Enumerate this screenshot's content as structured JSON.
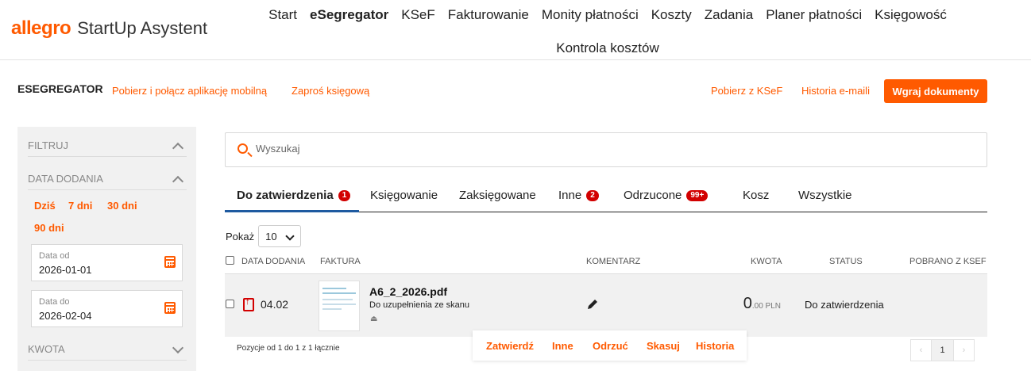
{
  "app": {
    "brand": "allegro",
    "subtitle": "StartUp Asystent"
  },
  "nav": {
    "items": [
      "Start",
      "eSegregator",
      "KSeF",
      "Fakturowanie",
      "Monity płatności",
      "Koszty",
      "Zadania",
      "Planer płatności",
      "Księgowość"
    ],
    "second_row": "Kontrola kosztów",
    "active": "eSegregator"
  },
  "toolbar": {
    "title": "ESEGREGATOR",
    "link_mobile": "Pobierz i połącz aplikację mobilną",
    "link_accountant": "Zaproś księgową",
    "link_ksef": "Pobierz z KSeF",
    "link_email": "Historia e-maili",
    "upload_button": "Wgraj dokumenty"
  },
  "sidebar": {
    "filter_label": "FILTRUJ",
    "date_section": "DATA DODANIA",
    "quick_ranges": [
      "Dziś",
      "7 dni",
      "30 dni",
      "90 dni"
    ],
    "date_from": {
      "label": "Data od",
      "value": "2026-01-01"
    },
    "date_to": {
      "label": "Data do",
      "value": "2026-02-04"
    },
    "amount_section": "KWOTA"
  },
  "search": {
    "placeholder": "Wyszukaj"
  },
  "tabs": [
    {
      "label": "Do zatwierdzenia",
      "badge": "1",
      "active": true
    },
    {
      "label": "Księgowanie",
      "badge": ""
    },
    {
      "label": "Zaksięgowane",
      "badge": ""
    },
    {
      "label": "Inne",
      "badge": "2"
    },
    {
      "label": "Odrzucone",
      "badge": "99+"
    },
    {
      "label": "Kosz",
      "badge": ""
    },
    {
      "label": "Wszystkie",
      "badge": ""
    }
  ],
  "table": {
    "show_label": "Pokaż",
    "page_size": "10",
    "columns": [
      "DATA DODANIA",
      "FAKTURA",
      "KOMENTARZ",
      "KWOTA",
      "STATUS",
      "POBRANO Z KSEF"
    ],
    "rows": [
      {
        "date": "04.02",
        "file_name": "A6_2_2026.pdf",
        "description": "Do uzupełnienia ze skanu",
        "amount_main": "0",
        "amount_rest": ".00 PLN",
        "status": "Do zatwierdzenia"
      }
    ]
  },
  "footer": {
    "info": "Pozycje od 1 do 1 z 1 łącznie",
    "actions": [
      "Zatwierdź",
      "Inne",
      "Odrzuć",
      "Skasuj",
      "Historia"
    ],
    "pager": {
      "prev": "‹",
      "current": "1",
      "next": "›"
    }
  },
  "colors": {
    "accent": "#ff5a00",
    "badge": "#d20000",
    "tab_underline": "#1e5aa0"
  }
}
